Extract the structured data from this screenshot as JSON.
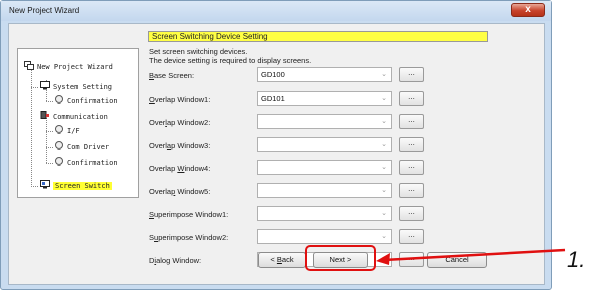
{
  "window": {
    "title": "New Project Wizard",
    "close_glyph": "x"
  },
  "tree": {
    "items": [
      {
        "label": "New Project Wizard",
        "icon": "project-wizard-icon"
      },
      {
        "label": "System Setting",
        "icon": "system-setting-icon"
      },
      {
        "label": "Confirmation",
        "icon": "confirmation-icon"
      },
      {
        "label": "Communication",
        "icon": "communication-icon"
      },
      {
        "label": "I/F",
        "icon": "interface-icon"
      },
      {
        "label": "Com Driver",
        "icon": "com-driver-icon"
      },
      {
        "label": "Confirmation",
        "icon": "confirmation-icon"
      },
      {
        "label": "Screen Switch",
        "icon": "screen-switch-icon",
        "selected": true
      }
    ]
  },
  "panel": {
    "header": "Screen Switching Device Setting",
    "description_1": "Set screen switching devices.",
    "description_2": "The device setting is required to display screens."
  },
  "rows": [
    {
      "accel": "B",
      "rest": "ase Screen:",
      "value": "GD100"
    },
    {
      "accel": "O",
      "rest": "verlap Window1:",
      "value": "GD101"
    },
    {
      "pre": "Over",
      "accel": "l",
      "rest": "ap Window2:",
      "value": ""
    },
    {
      "pre": "Overl",
      "accel": "a",
      "rest": "p Window3:",
      "value": ""
    },
    {
      "pre": "Overlap ",
      "accel": "W",
      "rest": "indow4:",
      "value": ""
    },
    {
      "pre": "Overla",
      "accel": "p",
      "rest": " Window5:",
      "value": ""
    },
    {
      "accel": "S",
      "rest": "uperimpose Window1:",
      "value": ""
    },
    {
      "pre": "S",
      "accel": "u",
      "rest": "perimpose Window2:",
      "value": ""
    },
    {
      "pre": "D",
      "accel": "i",
      "rest": "alog Window:",
      "value": ""
    }
  ],
  "browse_label": "...",
  "combo_arrow": "⌄",
  "buttons": {
    "back_prefix": "< ",
    "back_accel": "B",
    "back_rest": "ack",
    "next": "Next >",
    "cancel": "Cancel"
  },
  "annotation": {
    "label": "1.",
    "color": "#e01010"
  }
}
